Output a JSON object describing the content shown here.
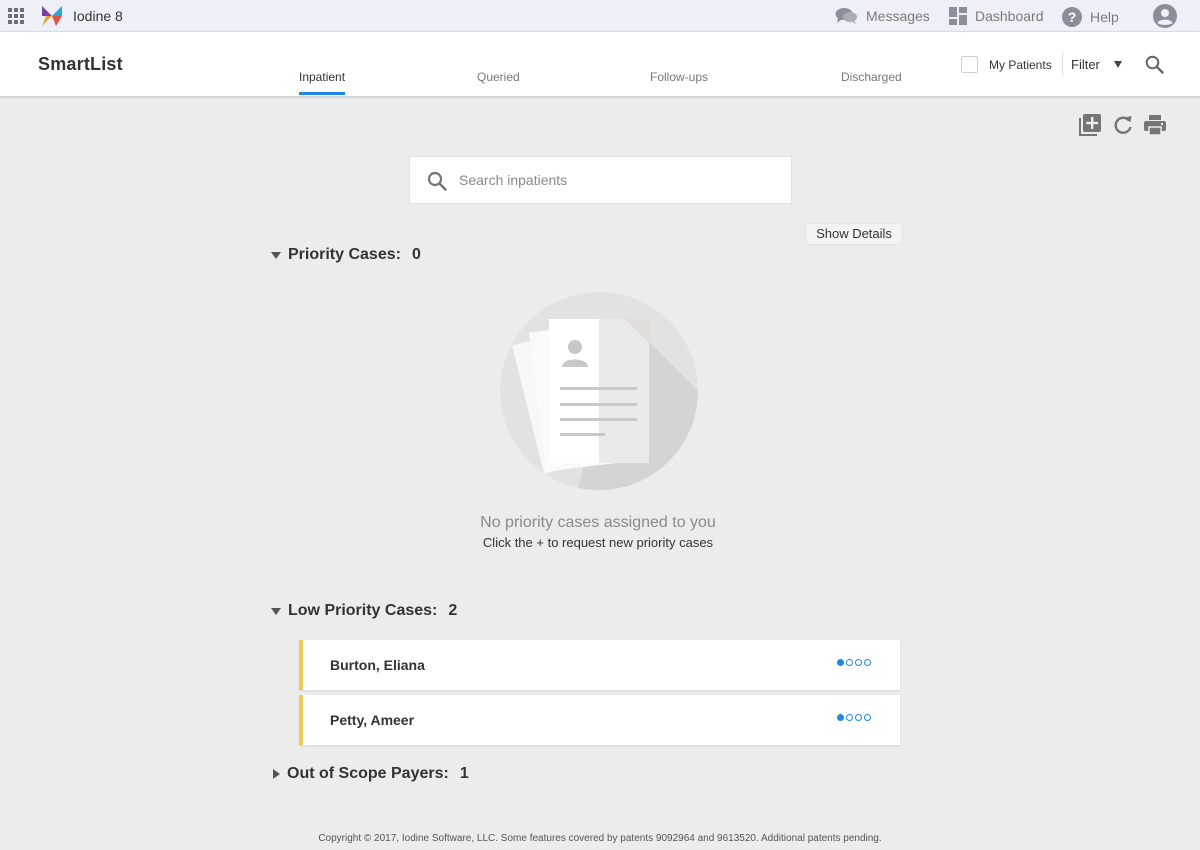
{
  "app": {
    "name": "Iodine 8"
  },
  "topnav": {
    "messages": "Messages",
    "dashboard": "Dashboard",
    "help": "Help"
  },
  "header": {
    "title": "SmartList",
    "tabs": [
      {
        "label": "Inpatient",
        "active": true
      },
      {
        "label": "Queried",
        "active": false
      },
      {
        "label": "Follow-ups",
        "active": false
      },
      {
        "label": "Discharged",
        "active": false
      }
    ],
    "my_patients_label": "My Patients",
    "my_patients_checked": false,
    "filter_label": "Filter"
  },
  "search": {
    "placeholder": "Search inpatients"
  },
  "show_details_label": "Show Details",
  "priority": {
    "label": "Priority Cases:",
    "count": "0",
    "empty_title": "No priority cases assigned to you",
    "empty_subtitle": "Click the + to request new priority cases"
  },
  "low_priority": {
    "label": "Low Priority Cases:",
    "count": "2",
    "cases": [
      {
        "name": "Burton, Eliana",
        "progress_filled": 1,
        "progress_total": 4
      },
      {
        "name": "Petty, Ameer",
        "progress_filled": 1,
        "progress_total": 4
      }
    ]
  },
  "out_of_scope": {
    "label": "Out of Scope Payers:",
    "count": "1"
  },
  "footer": {
    "copyright": "Copyright © 2017, Iodine Software, LLC. Some features covered by patents 9092964 and 9613520. Additional patents pending."
  },
  "colors": {
    "accent": "#1e88e5",
    "low_priority_bar": "#efcb54",
    "background": "#ececec"
  },
  "icons": [
    "apps-grid-icon",
    "iodine-logo-icon",
    "messages-icon",
    "dashboard-icon",
    "help-icon",
    "account-icon",
    "search-icon",
    "add-case-icon",
    "refresh-icon",
    "print-icon",
    "document-illustration"
  ]
}
